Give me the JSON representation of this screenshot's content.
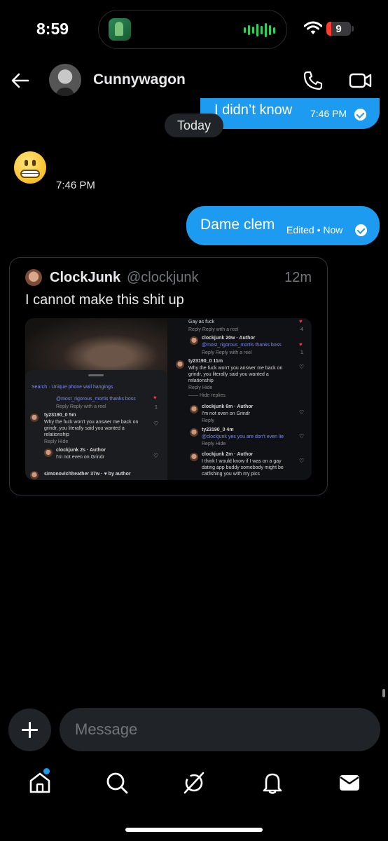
{
  "status_bar": {
    "time": "8:59",
    "battery": "9"
  },
  "header": {
    "name": "Cunnywagon"
  },
  "messages": {
    "out1": {
      "text": "I didn’t know",
      "time": "7:46 PM"
    },
    "date_divider": "Today",
    "in1": {
      "time": "7:46 PM"
    },
    "out2": {
      "text": "Dame clem",
      "meta": "Edited • Now"
    }
  },
  "post": {
    "author_name": "ClockJunk",
    "author_handle": "@clockjunk",
    "time": "12m",
    "text": "I cannot make this shit up",
    "screenshot_left": {
      "search": "Search · Unique phone wall hangings",
      "c1_text": "@most_rigorous_mortis thanks boss",
      "c1_actions": "Reply    Reply with a reel",
      "c1_count": "1",
      "c2_user": "ty23190_0 5m",
      "c2_line1": "Why the fuck won't you answer me back on",
      "c2_line2": "grindr, you literally said you wanted a",
      "c2_line3": "relationship",
      "c2_actions": "Reply    Hide",
      "c3_user": "clockjunk 2s · Author",
      "c3_text": "I'm not even on Grindr",
      "footer": "simonovichheather 37w · ♥ by author"
    },
    "screenshot_right": {
      "r0_text": "Gay as fuck",
      "r0_actions": "Reply    Reply with a reel",
      "r0_count": "4",
      "r1_user": "clockjunk 20w · Author",
      "r1_text": "@most_rigorous_mortis thanks boss",
      "r1_actions": "Reply    Reply with a reel",
      "r1_count": "1",
      "r2_user": "ty23190_0 11m",
      "r2_line1": "Why the fuck won't you answer me back on",
      "r2_line2": "grindr, you literally said you wanted a",
      "r2_line3": "relationship",
      "r2_actions": "Reply    Hide",
      "r2_hide": "—— Hide replies",
      "r3_user": "clockjunk 6m · Author",
      "r3_text": "I'm not even on Grindr",
      "r3_actions": "Reply",
      "r4_user": "ty23190_0 4m",
      "r4_text": "@clockjunk yes you are don't even lie",
      "r4_actions": "Reply    Hide",
      "r5_user": "clockjunk 2m · Author",
      "r5_line1": "I think I would know if I was on a gay",
      "r5_line2": "dating app buddy somebody might be",
      "r5_line3": "catfishing you with my pics"
    }
  },
  "composer": {
    "placeholder": "Message"
  },
  "icons": {
    "back": "arrow-left",
    "call": "phone",
    "video": "video-camera",
    "tabs": [
      "home",
      "search",
      "grok",
      "notifications",
      "messages"
    ]
  },
  "colors": {
    "accent": "#1d9bf0",
    "background": "#000000",
    "surface": "#202327"
  }
}
